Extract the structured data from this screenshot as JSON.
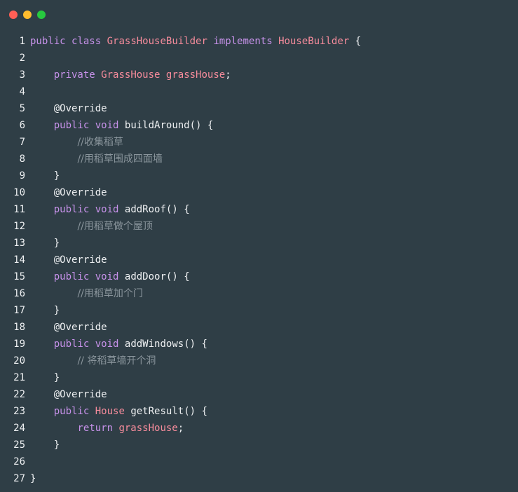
{
  "window": {
    "buttons": [
      {
        "name": "close",
        "color": "#ff5f56"
      },
      {
        "name": "minimize",
        "color": "#ffbd2e"
      },
      {
        "name": "maximize",
        "color": "#27c93f"
      }
    ]
  },
  "code": {
    "language": "java",
    "lines": [
      {
        "n": "1",
        "tokens": [
          [
            "kw",
            "public"
          ],
          [
            "plain",
            " "
          ],
          [
            "kw",
            "class"
          ],
          [
            "plain",
            " "
          ],
          [
            "type",
            "GrassHouseBuilder"
          ],
          [
            "plain",
            " "
          ],
          [
            "kw",
            "implements"
          ],
          [
            "plain",
            " "
          ],
          [
            "type",
            "HouseBuilder"
          ],
          [
            "plain",
            " {"
          ]
        ]
      },
      {
        "n": "2",
        "tokens": []
      },
      {
        "n": "3",
        "tokens": [
          [
            "plain",
            "    "
          ],
          [
            "kw",
            "private"
          ],
          [
            "plain",
            " "
          ],
          [
            "type",
            "GrassHouse"
          ],
          [
            "plain",
            " "
          ],
          [
            "type",
            "grassHouse"
          ],
          [
            "plain",
            ";"
          ]
        ]
      },
      {
        "n": "4",
        "tokens": []
      },
      {
        "n": "5",
        "tokens": [
          [
            "plain",
            "    "
          ],
          [
            "ann",
            "@Override"
          ]
        ]
      },
      {
        "n": "6",
        "tokens": [
          [
            "plain",
            "    "
          ],
          [
            "kw",
            "public"
          ],
          [
            "plain",
            " "
          ],
          [
            "kw",
            "void"
          ],
          [
            "plain",
            " "
          ],
          [
            "fn",
            "buildAround"
          ],
          [
            "plain",
            "() {"
          ]
        ]
      },
      {
        "n": "7",
        "tokens": [
          [
            "plain",
            "        "
          ],
          [
            "comment",
            "//收集稻草"
          ]
        ]
      },
      {
        "n": "8",
        "tokens": [
          [
            "plain",
            "        "
          ],
          [
            "comment",
            "//用稻草围成四面墙"
          ]
        ]
      },
      {
        "n": "9",
        "tokens": [
          [
            "plain",
            "    }"
          ]
        ]
      },
      {
        "n": "10",
        "tokens": [
          [
            "plain",
            "    "
          ],
          [
            "ann",
            "@Override"
          ]
        ]
      },
      {
        "n": "11",
        "tokens": [
          [
            "plain",
            "    "
          ],
          [
            "kw",
            "public"
          ],
          [
            "plain",
            " "
          ],
          [
            "kw",
            "void"
          ],
          [
            "plain",
            " "
          ],
          [
            "fn",
            "addRoof"
          ],
          [
            "plain",
            "() {"
          ]
        ]
      },
      {
        "n": "12",
        "tokens": [
          [
            "plain",
            "        "
          ],
          [
            "comment",
            "//用稻草做个屋顶"
          ]
        ]
      },
      {
        "n": "13",
        "tokens": [
          [
            "plain",
            "    }"
          ]
        ]
      },
      {
        "n": "14",
        "tokens": [
          [
            "plain",
            "    "
          ],
          [
            "ann",
            "@Override"
          ]
        ]
      },
      {
        "n": "15",
        "tokens": [
          [
            "plain",
            "    "
          ],
          [
            "kw",
            "public"
          ],
          [
            "plain",
            " "
          ],
          [
            "kw",
            "void"
          ],
          [
            "plain",
            " "
          ],
          [
            "fn",
            "addDoor"
          ],
          [
            "plain",
            "() {"
          ]
        ]
      },
      {
        "n": "16",
        "tokens": [
          [
            "plain",
            "        "
          ],
          [
            "comment",
            "//用稻草加个门"
          ]
        ]
      },
      {
        "n": "17",
        "tokens": [
          [
            "plain",
            "    }"
          ]
        ]
      },
      {
        "n": "18",
        "tokens": [
          [
            "plain",
            "    "
          ],
          [
            "ann",
            "@Override"
          ]
        ]
      },
      {
        "n": "19",
        "tokens": [
          [
            "plain",
            "    "
          ],
          [
            "kw",
            "public"
          ],
          [
            "plain",
            " "
          ],
          [
            "kw",
            "void"
          ],
          [
            "plain",
            " "
          ],
          [
            "fn",
            "addWindows"
          ],
          [
            "plain",
            "() {"
          ]
        ]
      },
      {
        "n": "20",
        "tokens": [
          [
            "plain",
            "        "
          ],
          [
            "comment",
            "// 将稻草墙开个洞"
          ]
        ]
      },
      {
        "n": "21",
        "tokens": [
          [
            "plain",
            "    }"
          ]
        ]
      },
      {
        "n": "22",
        "tokens": [
          [
            "plain",
            "    "
          ],
          [
            "ann",
            "@Override"
          ]
        ]
      },
      {
        "n": "23",
        "tokens": [
          [
            "plain",
            "    "
          ],
          [
            "kw",
            "public"
          ],
          [
            "plain",
            " "
          ],
          [
            "type",
            "House"
          ],
          [
            "plain",
            " "
          ],
          [
            "fn",
            "getResult"
          ],
          [
            "plain",
            "() {"
          ]
        ]
      },
      {
        "n": "24",
        "tokens": [
          [
            "plain",
            "        "
          ],
          [
            "kw",
            "return"
          ],
          [
            "plain",
            " "
          ],
          [
            "type",
            "grassHouse"
          ],
          [
            "plain",
            ";"
          ]
        ]
      },
      {
        "n": "25",
        "tokens": [
          [
            "plain",
            "    }"
          ]
        ]
      },
      {
        "n": "26",
        "tokens": []
      },
      {
        "n": "27",
        "tokens": [
          [
            "plain",
            "}"
          ]
        ]
      }
    ]
  }
}
